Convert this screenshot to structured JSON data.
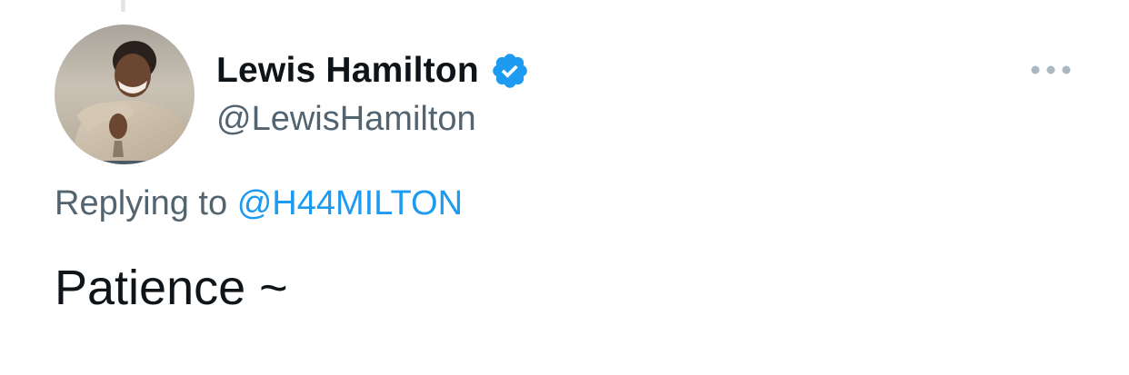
{
  "author": {
    "display_name": "Lewis Hamilton",
    "handle": "@LewisHamilton",
    "verified": true,
    "avatar_icon": "profile-photo",
    "verified_icon": "verified-badge-icon"
  },
  "reply": {
    "prefix": "Replying to",
    "target": "@H44MILTON"
  },
  "tweet": {
    "text": "Patience ~"
  },
  "menu": {
    "icon": "more-options-icon"
  },
  "colors": {
    "text_primary": "#0f1419",
    "text_secondary": "#536471",
    "accent": "#1d9bf0",
    "icon_muted": "#aab8c2"
  }
}
